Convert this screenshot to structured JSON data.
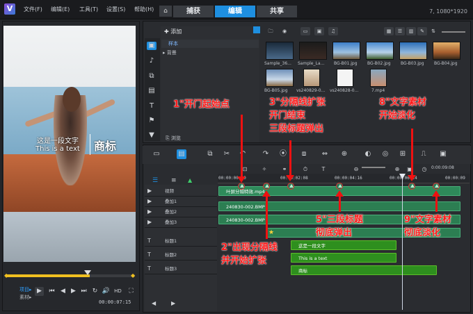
{
  "menubar": {
    "file": "文件(F)",
    "edit": "编辑(E)",
    "tools": "工具(T)",
    "settings": "设置(S)",
    "help": "帮助(H)",
    "tabs": [
      "捕获",
      "编辑",
      "共享"
    ],
    "resolution": "7, 1080*1920"
  },
  "player": {
    "caption_cn": "这是一段文字",
    "caption_en": "This is a text",
    "brand": "商标",
    "mode_project": "项目▸",
    "mode_clip": "素材▸",
    "hd": "HD",
    "timecode": "00:00:07:15",
    "scrub_position": 0.65
  },
  "library": {
    "add": "添加",
    "folders": [
      "样本",
      "背景"
    ],
    "browse": "浏览",
    "thumbs_row1": [
      "Sample_36...",
      "Sample_La...",
      "BG-B01.jpg",
      "BG-B02.jpg",
      "BG-B03.jpg",
      "BG-B04.jpg"
    ],
    "thumbs_row2": [
      "BG-B05.jpg",
      "vs240829-0...",
      "vs240828-0...",
      "7.mp4"
    ]
  },
  "timeline": {
    "ruler": [
      "00:00:00:00",
      "00:00:02:08",
      "00:00:04:16",
      "00:00:06:24",
      "00:00:09"
    ],
    "tracks": [
      "视频",
      "叠加1",
      "叠加2",
      "叠加3",
      "标题1",
      "标题2",
      "标题3"
    ],
    "clips": {
      "video": "叶屏分隔特效.mp4",
      "overlay1": "240830-002.BMP",
      "overlay2": "240830-002.BMP",
      "title1": "这是一段文字",
      "title2": "This is a text",
      "title3": "商标"
    }
  },
  "annotations": {
    "a1": "1\"开门起始点",
    "a2_1": "2\"出现分隔线",
    "a2_2": "并开始扩张",
    "a3_1": "3\"分隔线扩张",
    "a3_2": "开门结束",
    "a3_3": "三段标题弹出",
    "a5_1": "5\"三段标题",
    "a5_2": "彻底弹出",
    "a8_1": "8\"文字素材",
    "a8_2": "开始淡化",
    "a9_1": "9\"文字素材",
    "a9_2": "彻底淡化"
  },
  "colors": {
    "accent": "#1e8fe0",
    "annotation": "#ff1a1a",
    "title_clip": "#2e8f1e",
    "video_clip": "#2e8a5a"
  }
}
